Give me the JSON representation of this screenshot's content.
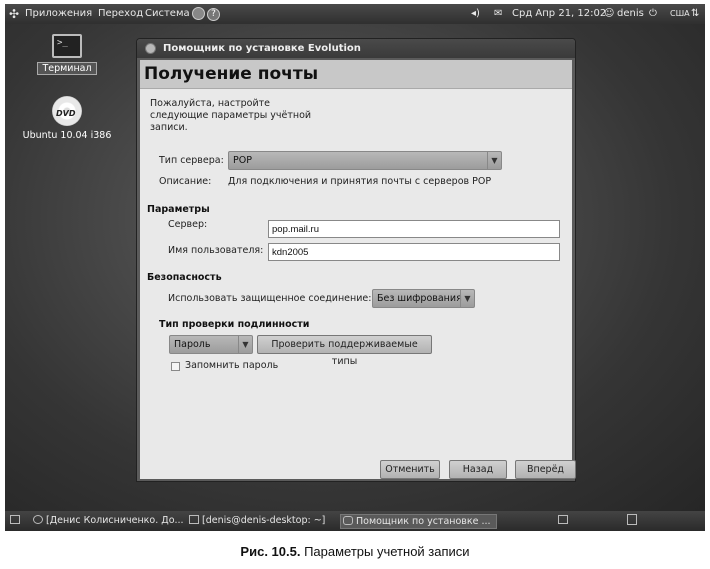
{
  "top_panel": {
    "menu_apps": "Приложения",
    "menu_places": "Переход",
    "menu_system": "Система",
    "datetime": "Срд Апр 21, 12:02",
    "user": "denis",
    "keyboard_layout": "США"
  },
  "desktop": {
    "terminal_icon_glyph": ">_",
    "terminal_label": "Терминал",
    "dvd_icon_text": "DVD",
    "dvd_label": "Ubuntu 10.04 i386"
  },
  "window": {
    "title": "Помощник по установке Evolution",
    "page_title": "Получение почты",
    "intro": [
      "Пожалуйста, настройте",
      "следующие параметры учётной",
      "записи."
    ],
    "server_type_label": "Тип сервера:",
    "server_type_value": "POP",
    "description_label": "Описание:",
    "description_value": "Для подключения и принятия почты с серверов POP",
    "params_heading": "Параметры",
    "server_label": "Сервер:",
    "server_value": "pop.mail.ru",
    "username_label": "Имя пользователя:",
    "username_value": "kdn2005",
    "security_heading": "Безопасность",
    "secure_conn_label": "Использовать защищенное соединение:",
    "secure_conn_value": "Без шифрования",
    "auth_heading": "Тип проверки подлинности",
    "auth_value": "Пароль",
    "check_types_button": "Проверить поддерживаемые типы",
    "remember_password": "Запомнить пароль",
    "cancel_button": "Отменить",
    "back_button": "Назад",
    "forward_button": "Вперёд"
  },
  "taskbar": {
    "task1": "[Денис Колисниченко. До...",
    "task2": "[denis@denis-desktop: ~]",
    "task3": "Помощник по установке ..."
  },
  "caption": {
    "label": "Рис. 10.5.",
    "text": "Параметры учетной записи"
  }
}
